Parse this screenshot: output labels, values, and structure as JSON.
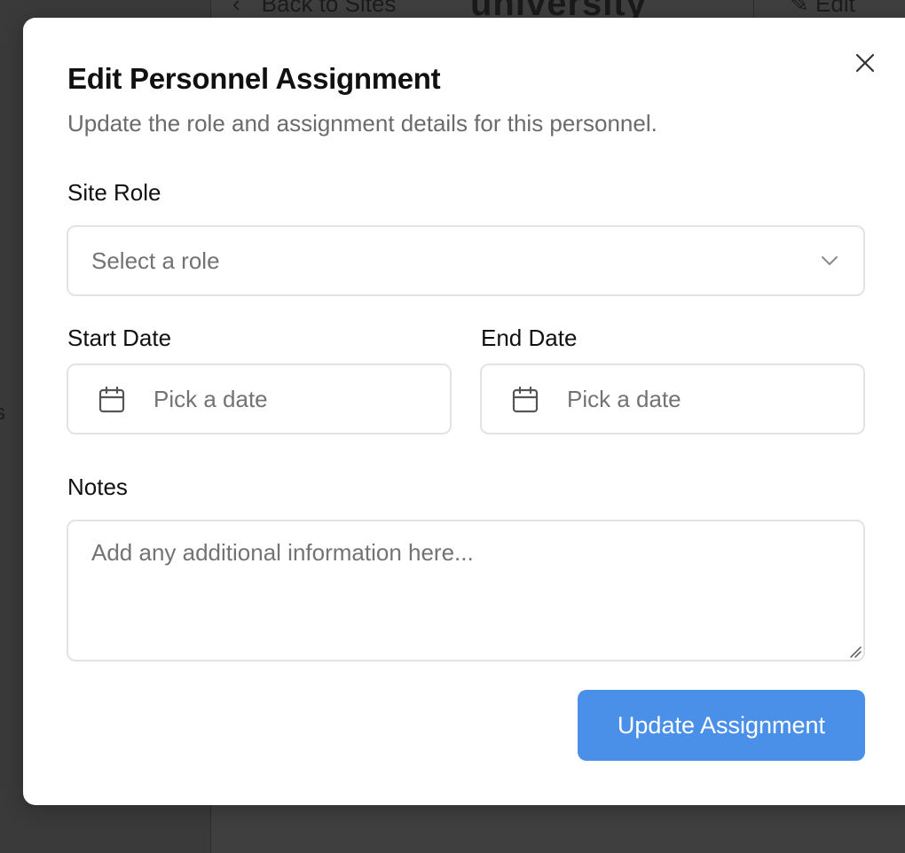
{
  "background": {
    "back_link": "Back to Sites",
    "logo_text": "university",
    "edit_label": "Edit",
    "side_letter": "s"
  },
  "modal": {
    "title": "Edit Personnel Assignment",
    "subtitle": "Update the role and assignment details for this personnel.",
    "close_icon": "close-icon",
    "site_role": {
      "label": "Site Role",
      "placeholder": "Select a role",
      "icon": "chevron-down-icon"
    },
    "start_date": {
      "label": "Start Date",
      "placeholder": "Pick a date",
      "icon": "calendar-icon"
    },
    "end_date": {
      "label": "End Date",
      "placeholder": "Pick a date",
      "icon": "calendar-icon"
    },
    "notes": {
      "label": "Notes",
      "placeholder": "Add any additional information here..."
    },
    "submit_label": "Update Assignment"
  },
  "colors": {
    "primary": "#4a90e8",
    "overlay": "#3d3d3d",
    "placeholder_text": "#737373"
  }
}
